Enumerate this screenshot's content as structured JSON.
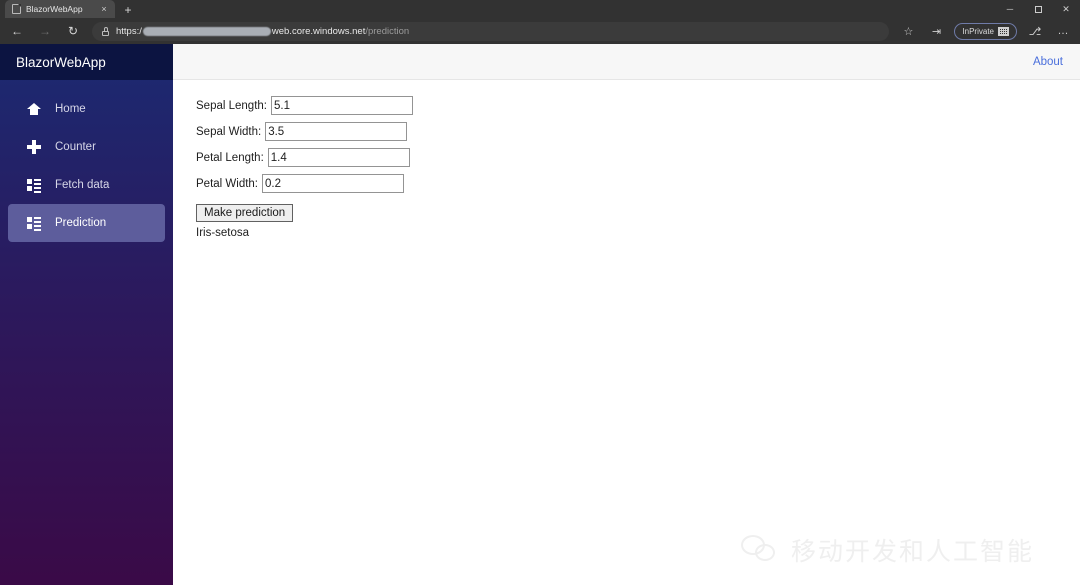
{
  "browser": {
    "tab": {
      "title": "BlazorWebApp",
      "close_label": "×",
      "favicon": "page-icon"
    },
    "newtab_label": "+",
    "window_controls": {
      "minimize": "─",
      "maximize": "",
      "close": "✕"
    },
    "nav": {
      "back": "←",
      "forward": "→",
      "reload": "↻"
    },
    "address": {
      "scheme": "https:/",
      "redacted": "",
      "host_bold": "web.core.windows.net",
      "path": "/prediction",
      "lock": "lock-icon"
    },
    "toolbar": {
      "favorite": "☆",
      "collections": "⇥",
      "inprivate_label": "InPrivate",
      "browser_essentials": "⎇",
      "settings_more": "…"
    }
  },
  "sidebar": {
    "brand": "BlazorWebApp",
    "items": [
      {
        "label": "Home",
        "icon": "home-icon",
        "active": false
      },
      {
        "label": "Counter",
        "icon": "plus-icon",
        "active": false
      },
      {
        "label": "Fetch data",
        "icon": "list-icon",
        "active": false
      },
      {
        "label": "Prediction",
        "icon": "list-icon",
        "active": true
      }
    ]
  },
  "content": {
    "about_link": "About",
    "form": {
      "fields": [
        {
          "label": "Sepal Length:",
          "value": "5.1"
        },
        {
          "label": "Sepal Width:",
          "value": "3.5"
        },
        {
          "label": "Petal Length:",
          "value": "1.4"
        },
        {
          "label": "Petal Width:",
          "value": "0.2"
        }
      ],
      "submit_label": "Make prediction",
      "result": "Iris-setosa"
    }
  },
  "watermark": {
    "text": "移动开发和人工智能",
    "icon": "wechat-icon"
  },
  "colors": {
    "sidebar_top": "#1b2a72",
    "sidebar_bottom": "#3a0a47",
    "brand_bg": "#0c1441",
    "active_item": "#5d5d9c",
    "link": "#4a6fdc",
    "topbar_bg": "#f7f7f7",
    "chrome_bg": "#323232"
  }
}
